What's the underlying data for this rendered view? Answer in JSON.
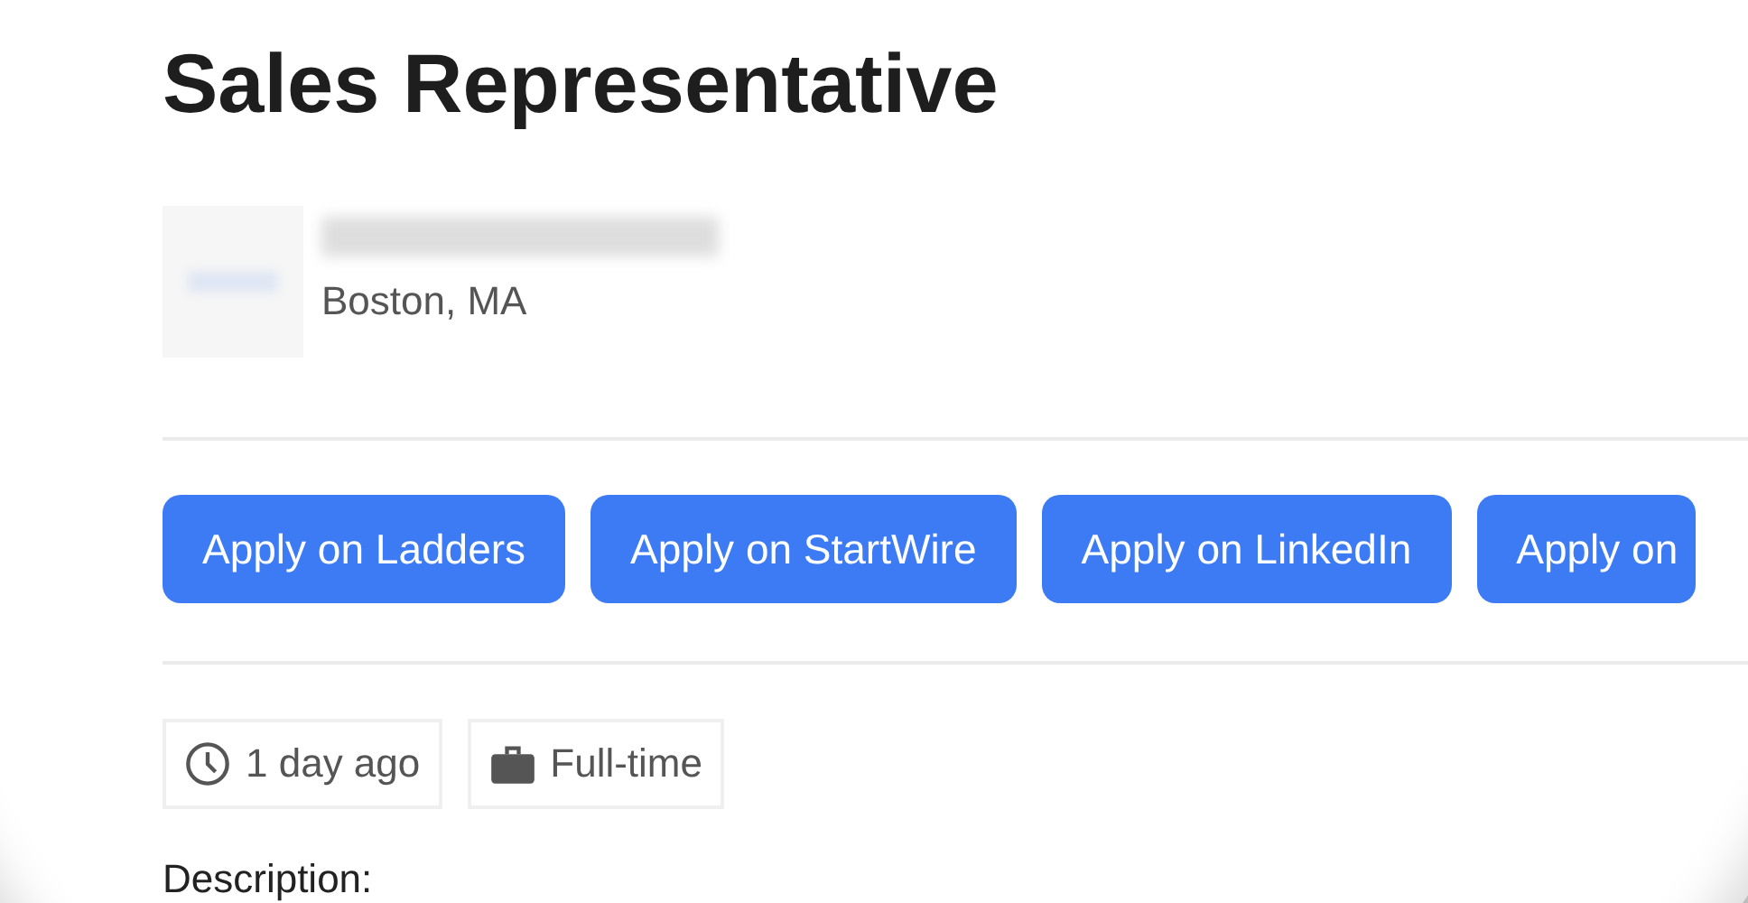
{
  "job": {
    "title": "Sales Representative",
    "location": "Boston, MA"
  },
  "apply_buttons": [
    {
      "label": "Apply on Ladders"
    },
    {
      "label": "Apply on StartWire"
    },
    {
      "label": "Apply on LinkedIn"
    },
    {
      "label": "Apply on"
    }
  ],
  "tags": [
    {
      "kind": "clock",
      "label": "1 day ago"
    },
    {
      "kind": "briefcase",
      "label": "Full-time"
    }
  ],
  "description_heading": "Description:"
}
